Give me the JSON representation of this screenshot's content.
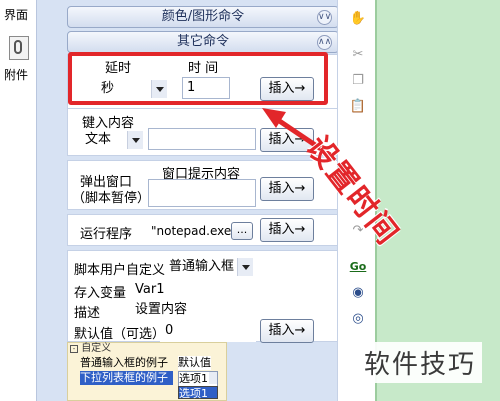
{
  "sidebar": {
    "item1_label": "界面",
    "item2_label": "附件"
  },
  "panels": {
    "color_header": "颜色/图形命令",
    "other_header": "其它命令"
  },
  "delay": {
    "col1_label": "延时",
    "col2_label": "时 间",
    "unit_value": "秒",
    "time_value": "1",
    "insert_label": "插入→"
  },
  "keyinput": {
    "label": "键入内容",
    "type_value": "文本",
    "insert_label": "插入→"
  },
  "popup": {
    "label_line1": "弹出窗口",
    "label_line2": "（脚本暂停）",
    "content_label": "窗口提示内容",
    "insert_label": "插入→"
  },
  "run": {
    "label": "运行程序",
    "value": "\"notepad.exe\"",
    "browse_label": "...",
    "insert_label": "插入→"
  },
  "custom": {
    "define_label": "脚本用户自定义",
    "define_value": "普通输入框",
    "var_label": "存入变量",
    "var_value": "Var1",
    "desc_label": "描述",
    "desc_value": "设置内容",
    "default_label": "默认值（可选）",
    "default_value": "0",
    "insert_label": "插入→"
  },
  "preview": {
    "header": "自定义",
    "row1_label": "普通输入框的例子",
    "row1_value": "默认值",
    "row2_label": "下拉列表框的例子",
    "row2_value": "选项1",
    "dropdown_option": "选项1"
  },
  "toolbar_icons": [
    "hand-icon",
    "cut-icon",
    "copy-icon",
    "paste-icon",
    "redo-icon",
    "goto-icon",
    "find-icon",
    "replace-icon"
  ],
  "toolbar_go_label": "Go",
  "annotation": "设置时间",
  "watermark": "软件技巧",
  "colors": {
    "panel_bg": "#d7e2f3",
    "highlight_red": "#e2262a",
    "right_area": "#c7e9c9"
  }
}
